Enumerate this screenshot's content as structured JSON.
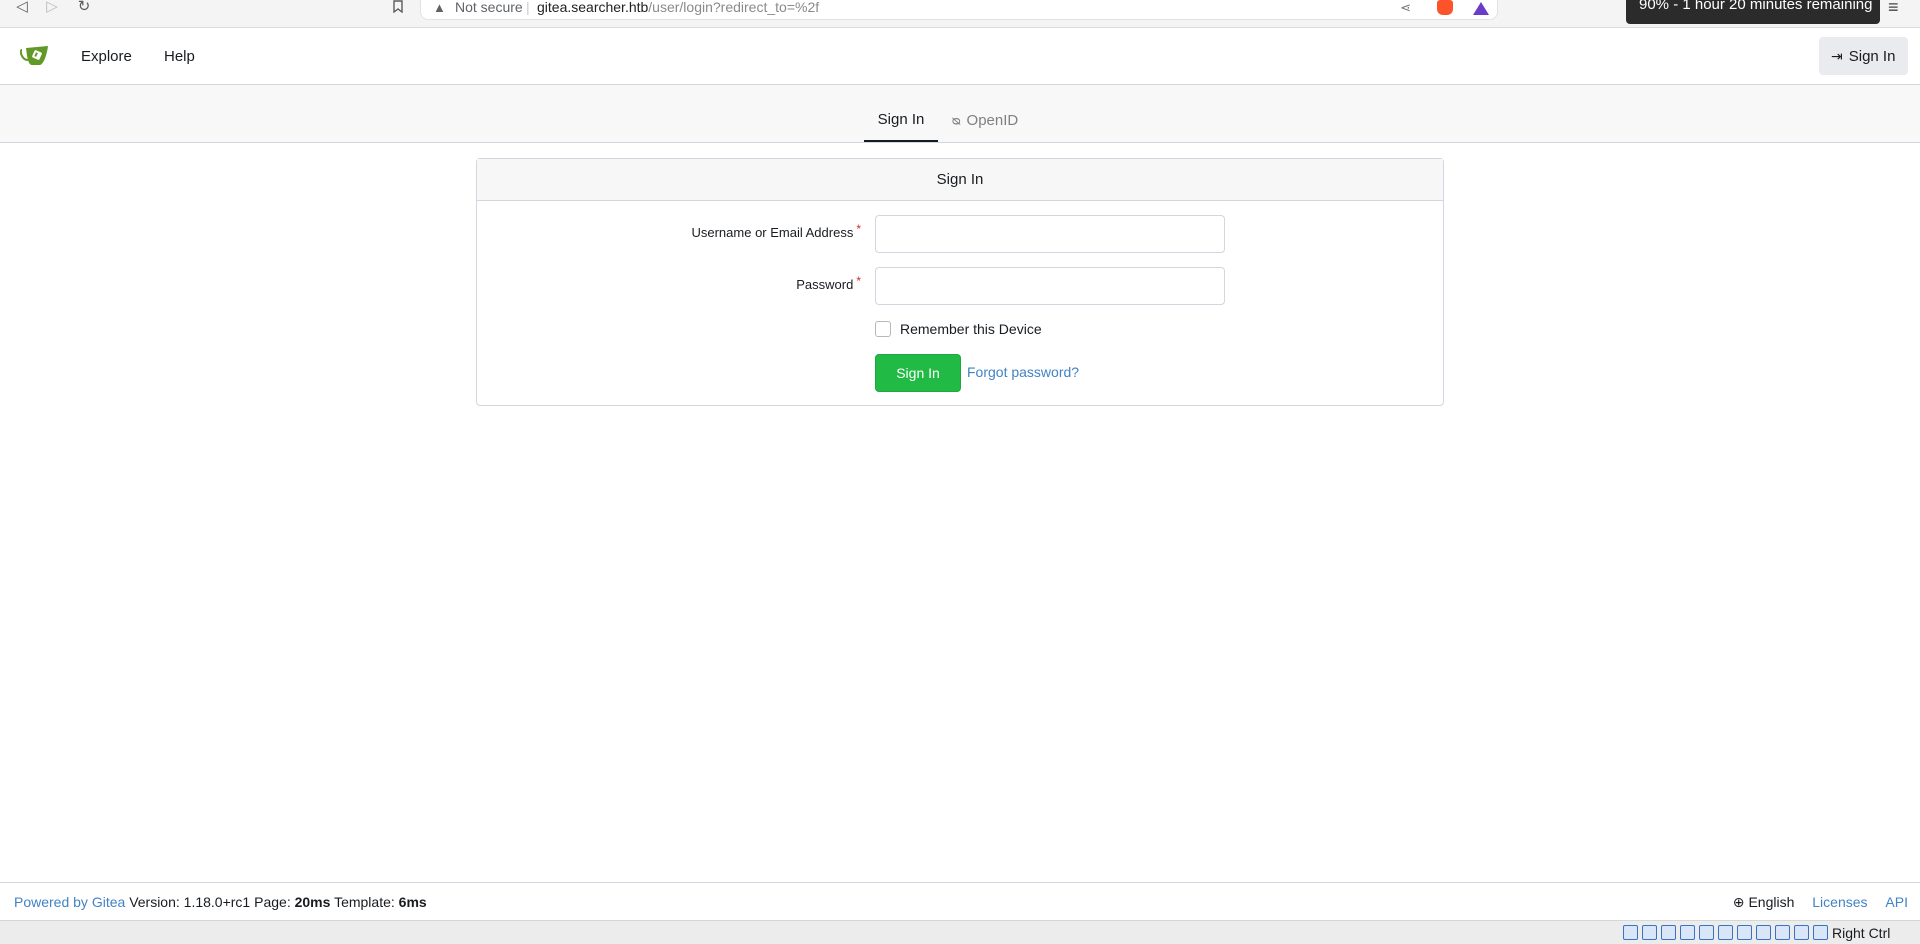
{
  "browser": {
    "back_icon": "back-arrow-icon",
    "forward_icon": "forward-arrow-icon",
    "reload_icon": "reload-icon",
    "bookmark_icon": "bookmark-icon",
    "security_label": "Not secure",
    "url_host": "gitea.searcher.htb",
    "url_path": "/user/login?redirect_to=%2f",
    "toast": "90% - 1 hour 20 minutes remaining"
  },
  "header": {
    "nav": {
      "explore": "Explore",
      "help": "Help"
    },
    "signin_label": "Sign In"
  },
  "tabs": {
    "signin": "Sign In",
    "openid": "OpenID"
  },
  "form": {
    "title": "Sign In",
    "username_label": "Username or Email Address",
    "password_label": "Password",
    "required_mark": "*",
    "username_value": "",
    "password_value": "",
    "remember_label": "Remember this Device",
    "remember_checked": false,
    "submit_label": "Sign In",
    "forgot_label": "Forgot password?"
  },
  "footer": {
    "powered_by": "Powered by Gitea",
    "version_label": "Version:",
    "version": "1.18.0+rc1",
    "page_label": "Page:",
    "page_time": "20ms",
    "template_label": "Template:",
    "template_time": "6ms",
    "language": "English",
    "licenses": "Licenses",
    "api": "API"
  },
  "taskbar": {
    "host_key": "Right Ctrl"
  },
  "colors": {
    "primary_button": "#21ba45",
    "link": "#4183c4",
    "required": "#db2828",
    "logo_green": "#609926"
  }
}
